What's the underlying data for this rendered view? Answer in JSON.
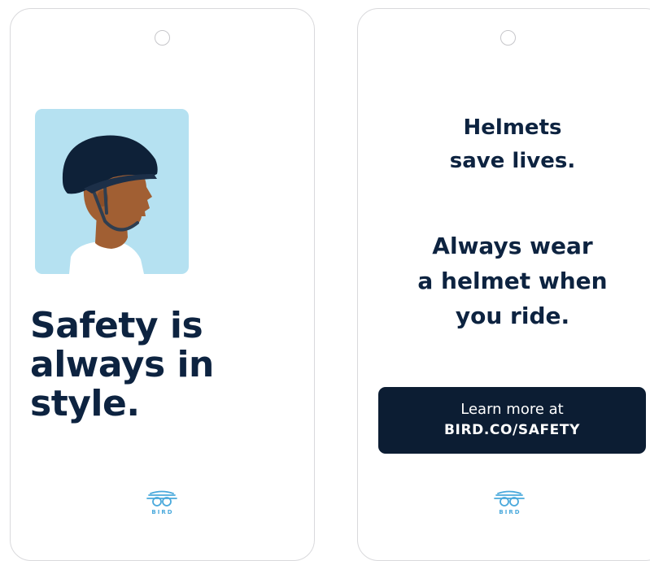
{
  "left_tag": {
    "headline_lines": [
      "Safety is",
      "always in",
      "style."
    ],
    "logo_text": "BIRD"
  },
  "right_tag": {
    "message_1_lines": [
      "Helmets",
      "save lives."
    ],
    "message_2_lines": [
      "Always wear",
      "a helmet when",
      "you ride."
    ],
    "cta": {
      "line1": "Learn more at",
      "line2": "BIRD.CO/SAFETY"
    },
    "logo_text": "BIRD"
  },
  "colors": {
    "navy": "#0d2340",
    "cta_background": "#0c1d33",
    "illustration_background": "#b5e1f1",
    "logo_blue": "#4aa9dc"
  },
  "icons": [
    "helmet-rider-illustration",
    "bird-logo-icon"
  ]
}
